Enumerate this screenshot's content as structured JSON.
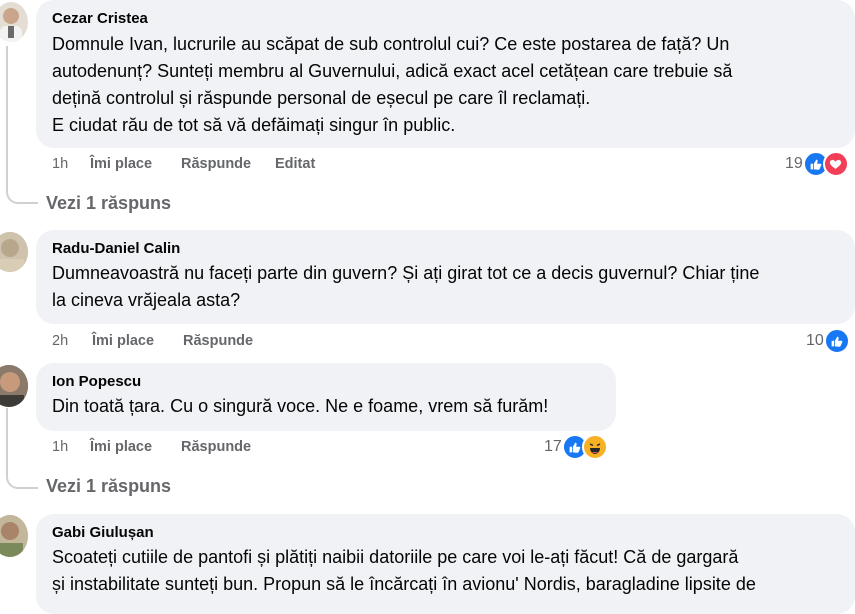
{
  "comments": [
    {
      "author": "Cezar Cristea",
      "text": "Domnule Ivan, lucrurile au scăpat de sub controlul cui? Ce este postarea de față? Un\nautodenunț? Sunteți membru al Guvernului, adică exact acel cetățean care trebuie să\ndețină controlul și răspunde personal de eșecul pe care îl reclamați.\nE ciudat rău de tot să vă defăimați singur în public.",
      "time": "1h",
      "like": "Îmi place",
      "reply": "Răspunde",
      "edited": "Editat",
      "reaction_count": "19",
      "reactions": [
        "like",
        "love"
      ],
      "replies": "Vezi 1 răspuns"
    },
    {
      "author": "Radu-Daniel Calin",
      "text": "Dumneavoastră nu faceți parte din guvern? Și ați girat tot ce a decis guvernul? Chiar ține\nla cineva vrăjeala asta?",
      "time": "2h",
      "like": "Îmi place",
      "reply": "Răspunde",
      "reaction_count": "10",
      "reactions": [
        "like"
      ]
    },
    {
      "author": "Ion Popescu",
      "text": "Din toată țara. Cu o singură voce. Ne e foame, vrem să furăm!",
      "time": "1h",
      "like": "Îmi place",
      "reply": "Răspunde",
      "reaction_count": "17",
      "reactions": [
        "like",
        "haha"
      ],
      "replies": "Vezi 1 răspuns"
    },
    {
      "author": "Gabi Giulușan",
      "text": "Scoateți cutiile de pantofi și plătiți naibii datoriile pe care voi le-ați făcut! Că de gargară\nși instabilitate sunteți bun. Propun să le încărcați în avionu' Nordis, baragladine lipsite de"
    }
  ],
  "colors": {
    "like": "#1877f2",
    "love": "#f33e58",
    "haha": "#f7b125",
    "bubble": "#f0f2f5",
    "meta": "#65676b"
  }
}
